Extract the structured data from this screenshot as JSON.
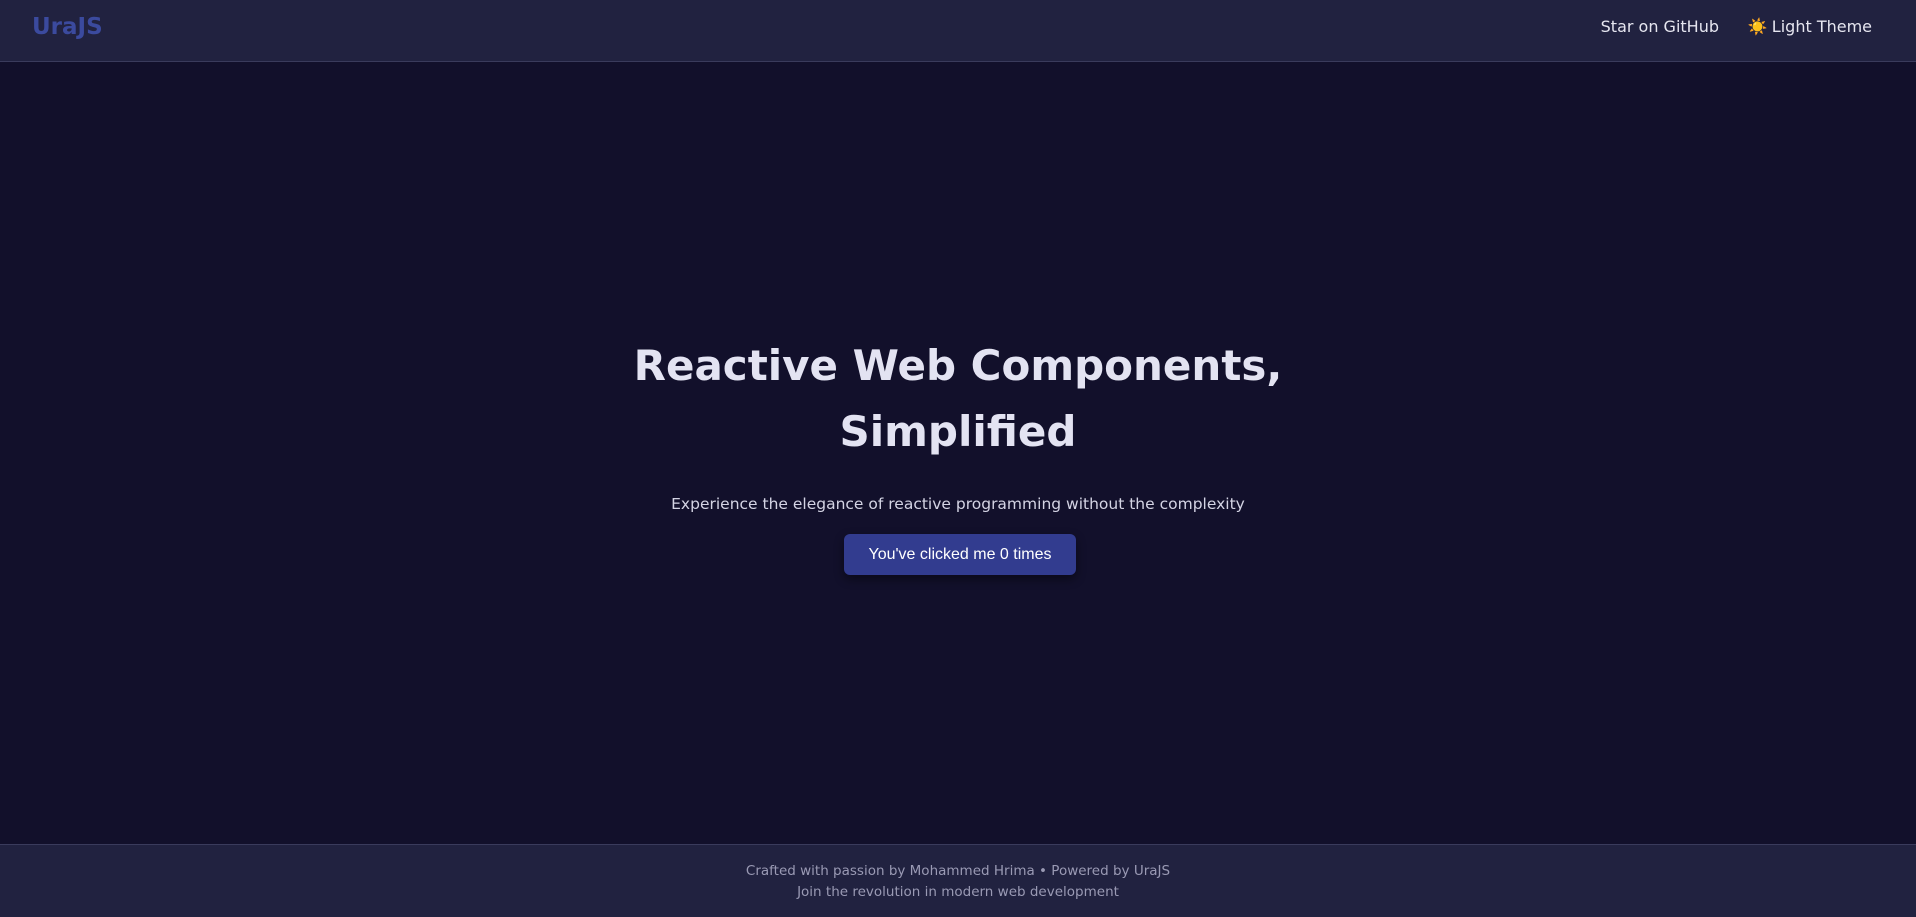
{
  "header": {
    "logo": "UraJS",
    "github_link": "Star on GitHub",
    "theme_toggle_icon": "☀️",
    "theme_toggle_label": "Light Theme"
  },
  "hero": {
    "title_line1": "Reactive Web Components,",
    "title_line2": "Simplified",
    "subtitle": "Experience the elegance of reactive programming without the complexity",
    "button_label": "You've clicked me 0 times"
  },
  "footer": {
    "line1": "Crafted with passion by Mohammed Hrima • Powered by UraJS",
    "line2": "Join the revolution in modern web development"
  },
  "colors": {
    "background": "#12102b",
    "header_bg": "#212240",
    "brand": "#3b4a9e",
    "button": "#323c8f"
  }
}
